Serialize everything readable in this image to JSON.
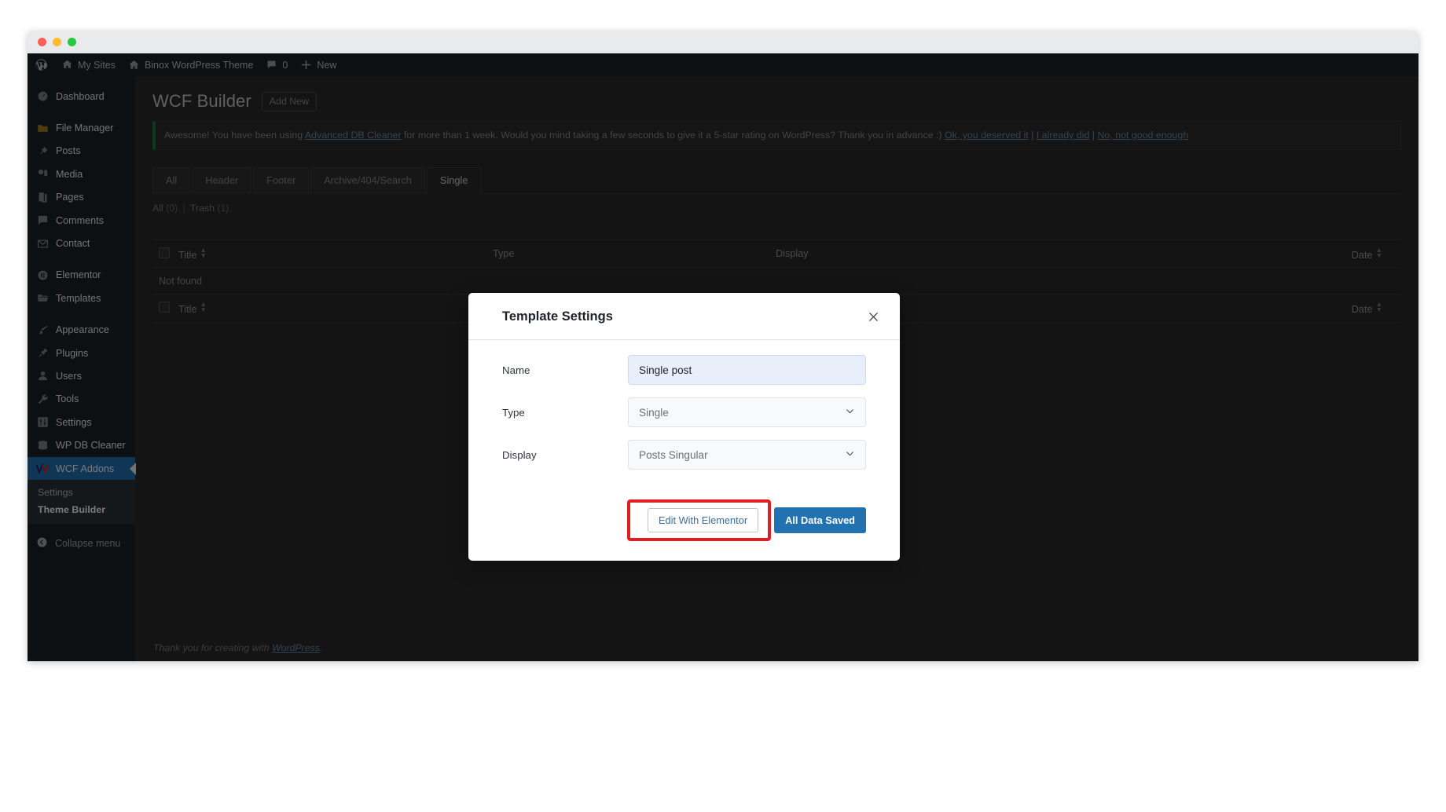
{
  "window": {
    "traffic_lights": [
      "close",
      "minimize",
      "maximize"
    ]
  },
  "adminbar": {
    "logo": "wordpress-logo",
    "items": [
      {
        "label": "My Sites",
        "icon": "sites-icon"
      },
      {
        "label": "Binox WordPress Theme",
        "icon": "home-icon"
      },
      {
        "label": "0",
        "icon": "comment-icon"
      },
      {
        "label": "New",
        "icon": "plus-icon"
      }
    ]
  },
  "sidebar": {
    "items": [
      {
        "label": "Dashboard",
        "icon": "dashboard-icon"
      },
      {
        "label": "File Manager",
        "icon": "folder-icon"
      },
      {
        "label": "Posts",
        "icon": "pin-icon"
      },
      {
        "label": "Media",
        "icon": "media-icon"
      },
      {
        "label": "Pages",
        "icon": "pages-icon"
      },
      {
        "label": "Comments",
        "icon": "comment-icon"
      },
      {
        "label": "Contact",
        "icon": "envelope-icon"
      },
      {
        "label": "Elementor",
        "icon": "elementor-icon"
      },
      {
        "label": "Templates",
        "icon": "templates-folder-icon"
      },
      {
        "label": "Appearance",
        "icon": "brush-icon"
      },
      {
        "label": "Plugins",
        "icon": "plug-icon"
      },
      {
        "label": "Users",
        "icon": "user-icon"
      },
      {
        "label": "Tools",
        "icon": "wrench-icon"
      },
      {
        "label": "Settings",
        "icon": "sliders-icon"
      },
      {
        "label": "WP DB Cleaner",
        "icon": "database-icon"
      },
      {
        "label": "WCF Addons",
        "icon": "wcf-logo-icon"
      }
    ],
    "submenu": [
      {
        "label": "Settings",
        "active": false
      },
      {
        "label": "Theme Builder",
        "active": true
      }
    ],
    "collapse_label": "Collapse menu",
    "active_color": "#2271b1"
  },
  "page": {
    "title": "WCF Builder",
    "add_new_label": "Add New"
  },
  "notice": {
    "text_1": "Awesome! You have been using ",
    "link_1": "Advanced DB Cleaner",
    "text_2": " for more than 1 week. Would you mind taking a few seconds to give it a 5-star rating on WordPress? Thank you in advance :) ",
    "link_2": "Ok, you deserved it",
    "sep_1": " | ",
    "link_3": "I already did",
    "sep_2": " | ",
    "link_4": "No, not good enough",
    "accent": "#1c7a3e"
  },
  "tabs": [
    {
      "label": "All",
      "active": false
    },
    {
      "label": "Header",
      "active": false
    },
    {
      "label": "Footer",
      "active": false
    },
    {
      "label": "Archive/404/Search",
      "active": false
    },
    {
      "label": "Single",
      "active": true
    }
  ],
  "subsubsub": {
    "all_label": "All",
    "all_count": "(0)",
    "separator": "|",
    "trash_label": "Trash",
    "trash_count": "(1)"
  },
  "table": {
    "columns": [
      "Title",
      "Type",
      "Display",
      "Date"
    ],
    "empty_message": "Not found"
  },
  "footer": {
    "text": "Thank you for creating with ",
    "link": "WordPress",
    "period": "."
  },
  "modal": {
    "title": "Template Settings",
    "close_icon": "close-icon",
    "fields": [
      {
        "label": "Name",
        "value": "Single post",
        "kind": "text"
      },
      {
        "label": "Type",
        "value": "Single",
        "kind": "select"
      },
      {
        "label": "Display",
        "value": "Posts Singular",
        "kind": "select"
      }
    ],
    "buttons": {
      "edit_elementor": "Edit With Elementor",
      "all_data_saved": "All Data Saved"
    },
    "highlight_color": "#e02020",
    "primary_color": "#2271b1"
  }
}
